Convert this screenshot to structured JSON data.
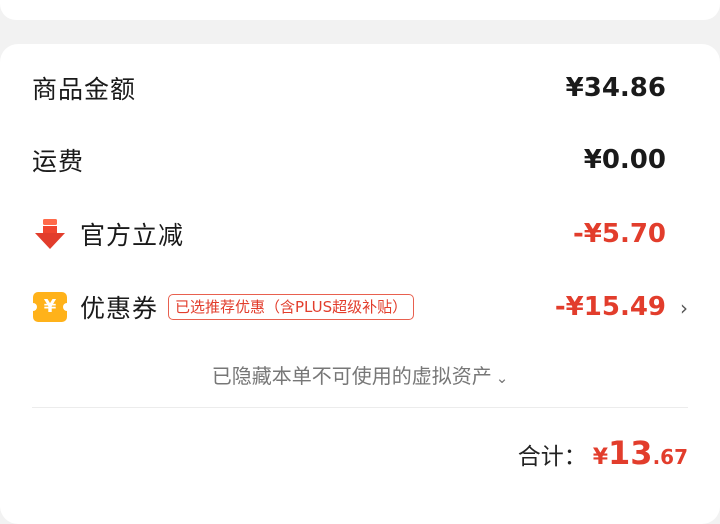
{
  "summary": {
    "items": [
      {
        "label": "商品金额",
        "value": "¥34.86"
      },
      {
        "label": "运费",
        "value": "¥0.00"
      },
      {
        "label": "官方立减",
        "value": "-¥5.70"
      },
      {
        "label": "优惠券",
        "value": "-¥15.49",
        "tag": "已选推荐优惠（含PLUS超级补贴）",
        "icon_char": "¥"
      }
    ],
    "hidden_note": "已隐藏本单不可使用的虚拟资产",
    "total": {
      "label": "合计：",
      "yen": "¥",
      "int": "13",
      "dec": ".67"
    }
  },
  "colors": {
    "accent_red": "#e23d2c",
    "coupon_yellow": "#ffb21a"
  },
  "icons": {
    "discount": "down-arrow-icon",
    "coupon": "coupon-icon",
    "more": "chevron-right-icon",
    "expand": "chevron-down-icon"
  }
}
